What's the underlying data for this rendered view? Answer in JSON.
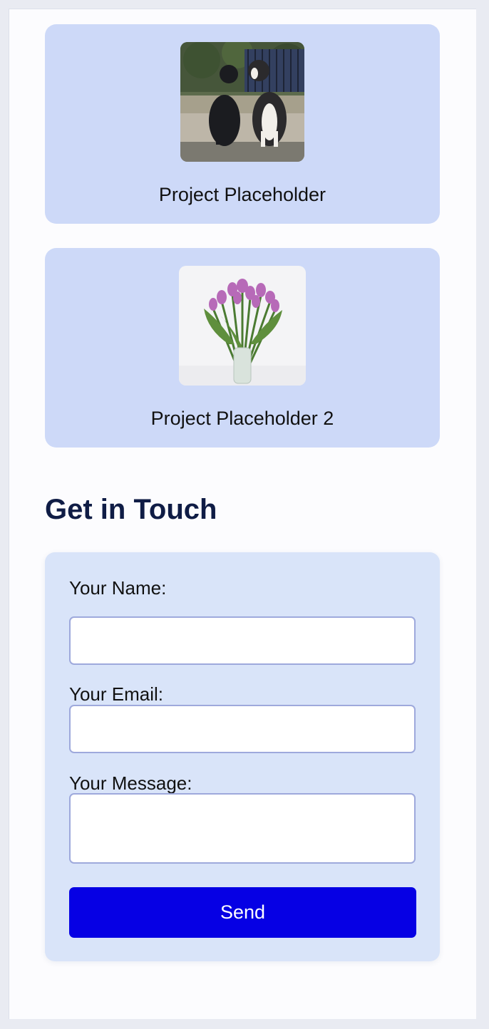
{
  "projects": [
    {
      "title": "Project Placeholder",
      "image": "two-dogs-photo"
    },
    {
      "title": "Project Placeholder 2",
      "image": "tulips-vase-photo"
    }
  ],
  "contact": {
    "heading": "Get in Touch",
    "name_label": "Your Name:",
    "name_value": "",
    "email_label": "Your Email:",
    "email_value": "",
    "message_label": "Your Message:",
    "message_value": "",
    "send_label": "Send"
  },
  "colors": {
    "page_bg": "#e9ebf2",
    "card_bg": "#cdd9f8",
    "form_bg": "#d9e4f9",
    "heading": "#0f1c45",
    "button": "#0600e4",
    "field_border": "#9ea9dc"
  }
}
